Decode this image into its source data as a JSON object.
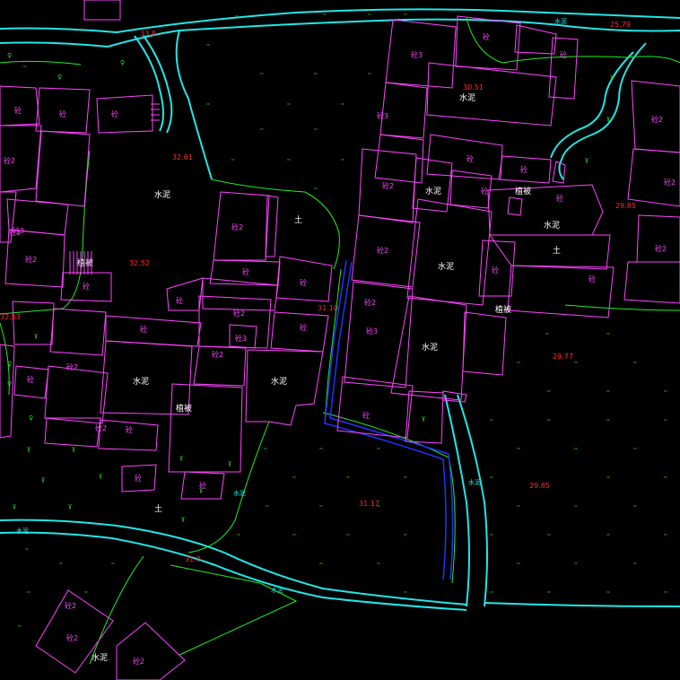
{
  "colors": {
    "background": "#000000",
    "building": "#ff44ff",
    "road": "#22e6e6",
    "vegetation_boundary": "#22ee22",
    "water": "#2233ff",
    "elevation": "#ff2a2a",
    "label": "#ffffff"
  },
  "elevations": [
    {
      "id": "e1",
      "text": "33.8"
    },
    {
      "id": "e2",
      "text": "25.79"
    },
    {
      "id": "e3",
      "text": "30.51"
    },
    {
      "id": "e4",
      "text": "32.61"
    },
    {
      "id": "e5",
      "text": "29.85"
    },
    {
      "id": "e6",
      "text": "32.52"
    },
    {
      "id": "e7",
      "text": "31.10"
    },
    {
      "id": "e8",
      "text": "32.53"
    },
    {
      "id": "e9",
      "text": "29.77"
    },
    {
      "id": "e10",
      "text": "29.85"
    },
    {
      "id": "e11",
      "text": "31.17"
    },
    {
      "id": "e12",
      "text": "31.8"
    }
  ],
  "ground_labels": [
    {
      "id": "g1",
      "text": "水泥"
    },
    {
      "id": "g2",
      "text": "水泥"
    },
    {
      "id": "g3",
      "text": "水泥"
    },
    {
      "id": "g4",
      "text": "水泥"
    },
    {
      "id": "g5",
      "text": "水泥"
    },
    {
      "id": "g6",
      "text": "水泥"
    },
    {
      "id": "g7",
      "text": "水泥"
    },
    {
      "id": "g8",
      "text": "土"
    },
    {
      "id": "g9",
      "text": "土"
    },
    {
      "id": "g10",
      "text": "土"
    },
    {
      "id": "g11",
      "text": "水泥"
    },
    {
      "id": "g12",
      "text": "水泥"
    }
  ],
  "vegetation_labels": [
    {
      "id": "v1",
      "text": "植被"
    },
    {
      "id": "v2",
      "text": "植被"
    },
    {
      "id": "v3",
      "text": "植被"
    },
    {
      "id": "v4",
      "text": "植被"
    }
  ],
  "building_labels": [
    {
      "id": "b1",
      "text": "砼3"
    },
    {
      "id": "b2",
      "text": "砼"
    },
    {
      "id": "b3",
      "text": "砼"
    },
    {
      "id": "b4",
      "text": "砼3"
    },
    {
      "id": "b5",
      "text": "砼2"
    },
    {
      "id": "b6",
      "text": "砼"
    },
    {
      "id": "b7",
      "text": "砼2"
    },
    {
      "id": "b8",
      "text": "砼2"
    },
    {
      "id": "b9",
      "text": "砼"
    },
    {
      "id": "b10",
      "text": "砼"
    },
    {
      "id": "b11",
      "text": "砼"
    },
    {
      "id": "b12",
      "text": "砼2"
    },
    {
      "id": "b13",
      "text": "砼"
    },
    {
      "id": "b14",
      "text": "砼3"
    },
    {
      "id": "b15",
      "text": "砼"
    },
    {
      "id": "b16",
      "text": "砼2"
    },
    {
      "id": "b17",
      "text": "砼3"
    },
    {
      "id": "b18",
      "text": "砼2"
    },
    {
      "id": "b19",
      "text": "砼"
    },
    {
      "id": "b20",
      "text": "砼2"
    },
    {
      "id": "b21",
      "text": "砼"
    },
    {
      "id": "b22",
      "text": "砼"
    },
    {
      "id": "b23",
      "text": "砼3"
    },
    {
      "id": "b24",
      "text": "砼2"
    },
    {
      "id": "b25",
      "text": "砼2"
    },
    {
      "id": "b26",
      "text": "砼"
    },
    {
      "id": "b27",
      "text": "砼"
    },
    {
      "id": "b28",
      "text": "砼2"
    },
    {
      "id": "b29",
      "text": "砼"
    },
    {
      "id": "b30",
      "text": "砼2"
    },
    {
      "id": "b31",
      "text": "砼"
    },
    {
      "id": "b32",
      "text": "砼"
    },
    {
      "id": "b33",
      "text": "砼"
    },
    {
      "id": "b34",
      "text": "砼2"
    },
    {
      "id": "b35",
      "text": "砼"
    },
    {
      "id": "b36",
      "text": "砼"
    },
    {
      "id": "b37",
      "text": "砼"
    },
    {
      "id": "b38",
      "text": "砼2"
    },
    {
      "id": "b39",
      "text": "砼2"
    },
    {
      "id": "b40",
      "text": "砼"
    },
    {
      "id": "b41",
      "text": "砼2"
    },
    {
      "id": "b42",
      "text": "砼"
    },
    {
      "id": "b43",
      "text": "砼3"
    },
    {
      "id": "b44",
      "text": "砼2"
    }
  ],
  "road_labels": [
    {
      "id": "r1",
      "text": "水泥"
    },
    {
      "id": "r2",
      "text": "水泥"
    },
    {
      "id": "r3",
      "text": "水泥"
    },
    {
      "id": "r4",
      "text": "水泥"
    },
    {
      "id": "r5",
      "text": "水泥"
    }
  ]
}
